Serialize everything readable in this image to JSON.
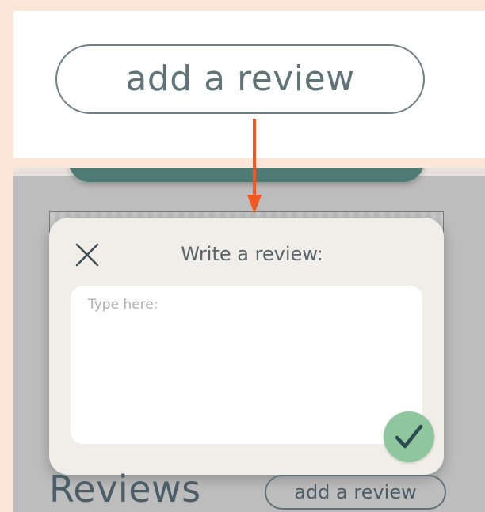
{
  "zoom": {
    "button_label": "add a review"
  },
  "modal": {
    "title": "Write a review:",
    "textarea_placeholder": "Type here:"
  },
  "reviews": {
    "heading": "Reviews",
    "add_button_label": "add a review"
  },
  "icons": {
    "close": "close-icon",
    "submit": "checkmark-icon",
    "arrow": "arrow-down-icon"
  },
  "colors": {
    "page_background": "#fbe6d8",
    "gray_screen": "#bdbdbd",
    "modal_background": "#f1eee9",
    "accent_teal": "#4e7c74",
    "submit_green": "#8ec79d",
    "callout_orange": "#f05a22",
    "text_dark": "#4b5d66"
  }
}
